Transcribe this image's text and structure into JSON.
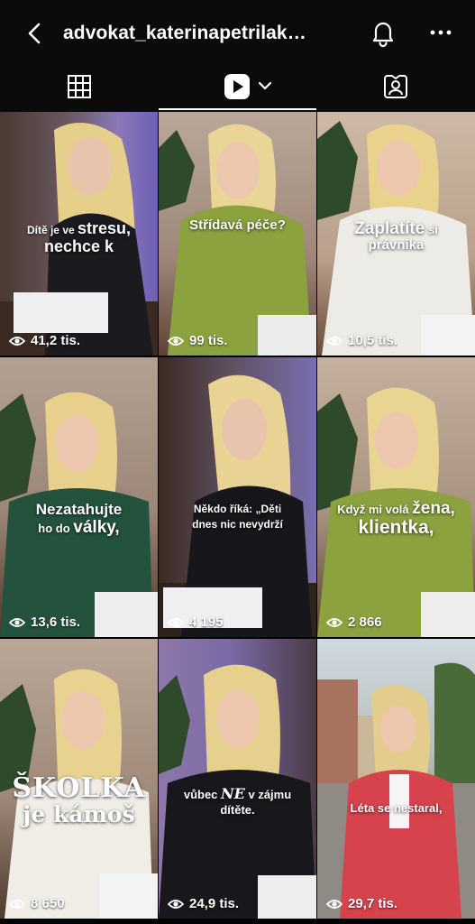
{
  "header": {
    "username": "advokat_katerinapetrilak…"
  },
  "tabs": [
    {
      "name": "grid",
      "icon": "grid-icon"
    },
    {
      "name": "reels",
      "icon": "reels-play-icon",
      "active": true
    },
    {
      "name": "tagged",
      "icon": "tagged-person-icon"
    }
  ],
  "reels": [
    {
      "caption_a": "Dítě je ve ",
      "caption_b": "stresu,",
      "caption_c": "nechce k",
      "views": "41,2 tis."
    },
    {
      "caption_a": "Střídavá péče?",
      "views": "99 tis."
    },
    {
      "caption_a": "Zaplatíte",
      "caption_b": " si",
      "caption_c": "právníka",
      "views": "10,5 tis."
    },
    {
      "caption_a": "Nezatahujte",
      "caption_b": "ho do ",
      "caption_c": "války,",
      "views": "13,6 tis."
    },
    {
      "caption_a": "Někdo říká: „Děti",
      "caption_b": "dnes nic nevydrží",
      "views": "4 195"
    },
    {
      "caption_a": "Když mi volá ",
      "caption_b": "žena,",
      "caption_c": "klientka,",
      "views": "2 866"
    },
    {
      "caption_a": "ŠKOLKA",
      "caption_b": "je kámoš",
      "views": "8 650"
    },
    {
      "caption_a": "vůbec ",
      "caption_b": "NE",
      "caption_c": " v zájmu",
      "caption_d": "dítěte.",
      "views": "24,9 tis."
    },
    {
      "caption_a": "Léta se nestaral,",
      "views": "29,7 tis."
    }
  ]
}
